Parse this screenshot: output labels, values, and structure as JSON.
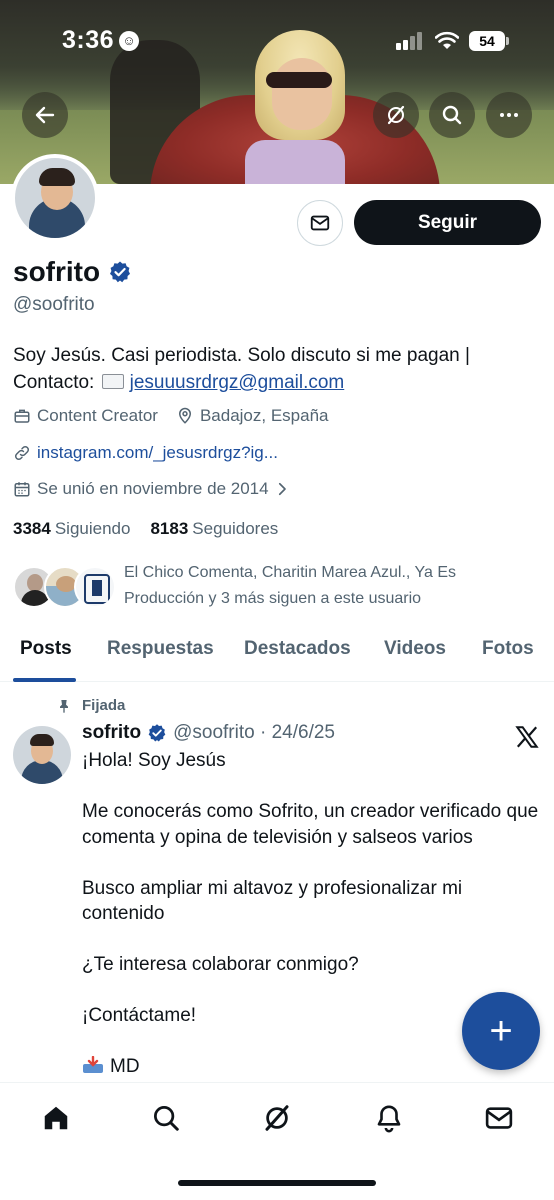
{
  "status_bar": {
    "time": "3:36",
    "battery": "54"
  },
  "profile": {
    "display_name": "sofrito",
    "handle": "@soofrito",
    "follow_label": "Seguir",
    "bio_text": "Soy Jesús. Casi periodista. Solo discuto si me pagan | Contacto: ",
    "bio_email": "jesuuusrdrgz@gmail.com",
    "category": "Content Creator",
    "location": "Badajoz, España",
    "link": "instagram.com/_jesusrdrgz?ig...",
    "joined": "Se unió en noviembre de 2014",
    "following_count": "3384",
    "following_label": "Siguiendo",
    "followers_count": "8183",
    "followers_label": "Seguidores",
    "followed_by": "El Chico Comenta, Charitin Marea Azul., Ya Es Producción y 3 más siguen a este usuario"
  },
  "tabs": [
    {
      "label": "Posts",
      "active": true
    },
    {
      "label": "Respuestas",
      "active": false
    },
    {
      "label": "Destacados",
      "active": false
    },
    {
      "label": "Videos",
      "active": false
    },
    {
      "label": "Fotos",
      "active": false
    }
  ],
  "pinned_post": {
    "pinned_label": "Fijada",
    "author": "sofrito",
    "handle_date": "@soofrito · 24/6/25",
    "lines": [
      "¡Hola! Soy Jesús",
      "",
      "Me conocerás como Sofrito, un creador verificado que comenta y opina de televisión y salseos varios",
      "",
      "Busco ampliar mi altavoz y profesionalizar mi contenido",
      "",
      "¿Te interesa colaborar conmigo?",
      "",
      "¡Contáctame!",
      ""
    ],
    "last_line": "MD"
  },
  "colors": {
    "accent": "#1d4e9c",
    "text": "#0f1419",
    "muted": "#536471"
  },
  "icons": [
    "back-arrow-icon",
    "grok-icon",
    "search-icon",
    "more-icon",
    "mail-icon",
    "verified-icon",
    "briefcase-icon",
    "location-icon",
    "link-icon",
    "calendar-icon",
    "pin-icon",
    "x-logo-icon",
    "compose-icon",
    "home-icon",
    "notifications-icon",
    "messages-icon"
  ]
}
